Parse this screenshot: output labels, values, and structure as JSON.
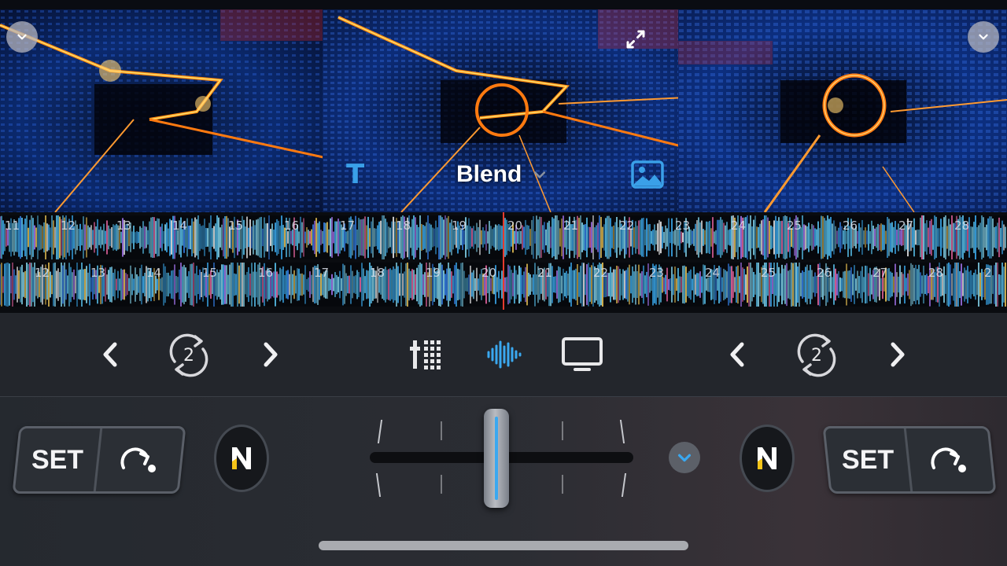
{
  "video": {
    "blend_label": "Blend",
    "text_tool_label": "T",
    "icons": {
      "left_corner": "chevron-down-icon",
      "right_corner": "chevron-down-icon",
      "center_expand": "expand-icon",
      "image_tool": "image-icon",
      "blend_dropdown": "chevron-down-icon"
    }
  },
  "waveforms": {
    "deck_top_beats": [
      "11",
      "12",
      "13",
      "14",
      "15",
      "16",
      "17",
      "18",
      "19",
      "20",
      "21",
      "22",
      "23",
      "24",
      "25",
      "26",
      "27",
      "28"
    ],
    "deck_bottom_beats": [
      "12",
      "13",
      "14",
      "15",
      "16",
      "17",
      "18",
      "19",
      "20",
      "21",
      "22",
      "23",
      "24",
      "25",
      "26",
      "27",
      "28",
      "2"
    ]
  },
  "toolbar": {
    "left_loop_value": "2",
    "right_loop_value": "2",
    "icons": [
      "chevron-left-icon",
      "loop-icon",
      "chevron-right-icon",
      "mixer-icon",
      "waveform-icon",
      "screen-icon"
    ]
  },
  "decks": {
    "left": {
      "set_label": "SET"
    },
    "right": {
      "set_label": "SET"
    }
  },
  "colors": {
    "accent": "#3aa8f0",
    "playhead": "#e63b2e",
    "neural_yellow": "#f5c518"
  }
}
